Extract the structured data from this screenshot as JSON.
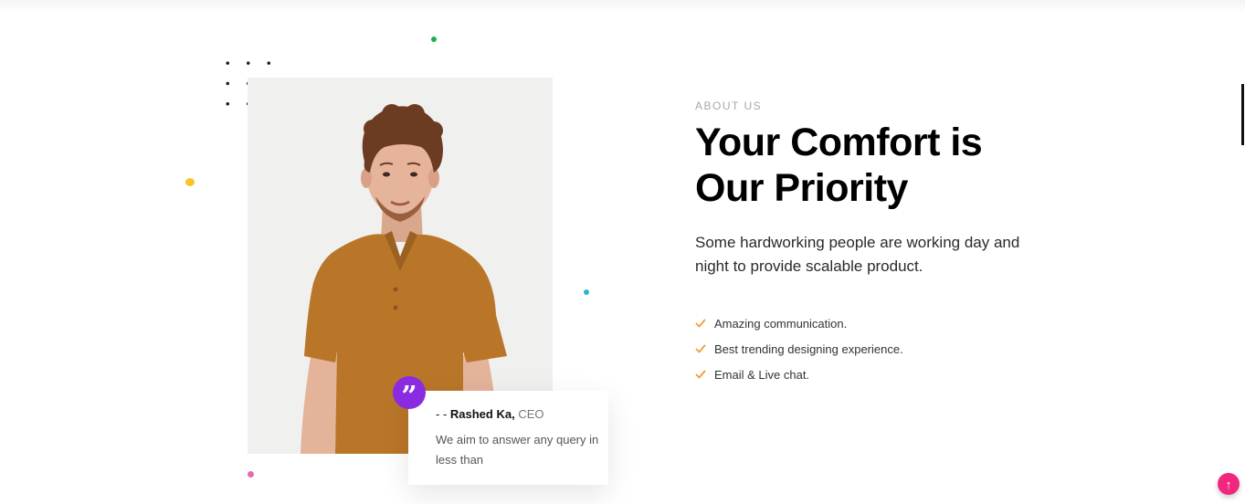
{
  "about": {
    "eyebrow": "ABOUT US",
    "headline_line1": "Your Comfort is",
    "headline_line2": "Our Priority",
    "lead": "Some hardworking people are working day and night to provide scalable product.",
    "features": [
      "Amazing communication.",
      "Best trending designing experience.",
      "Email & Live chat."
    ]
  },
  "quote": {
    "prefix": "- - ",
    "name": "Rashed Ka,",
    "role": " CEO",
    "text": "We aim to answer any query in less than",
    "mark": "”"
  },
  "icons": {
    "feature_icon": "check-icon",
    "quote_icon": "quote-icon",
    "scroll_icon": "arrow-up-icon"
  },
  "scroll_top": {
    "symbol": "↑"
  },
  "colors": {
    "accent_purple": "#8a2be2",
    "check_orange": "#f29b38",
    "scroll_pink": "#f0277e",
    "dot_green": "#1bb24c",
    "dot_yellow": "#f9c32b",
    "dot_teal": "#2bb6cc",
    "dot_pink": "#e36ab0",
    "shirt": "#b97629"
  }
}
